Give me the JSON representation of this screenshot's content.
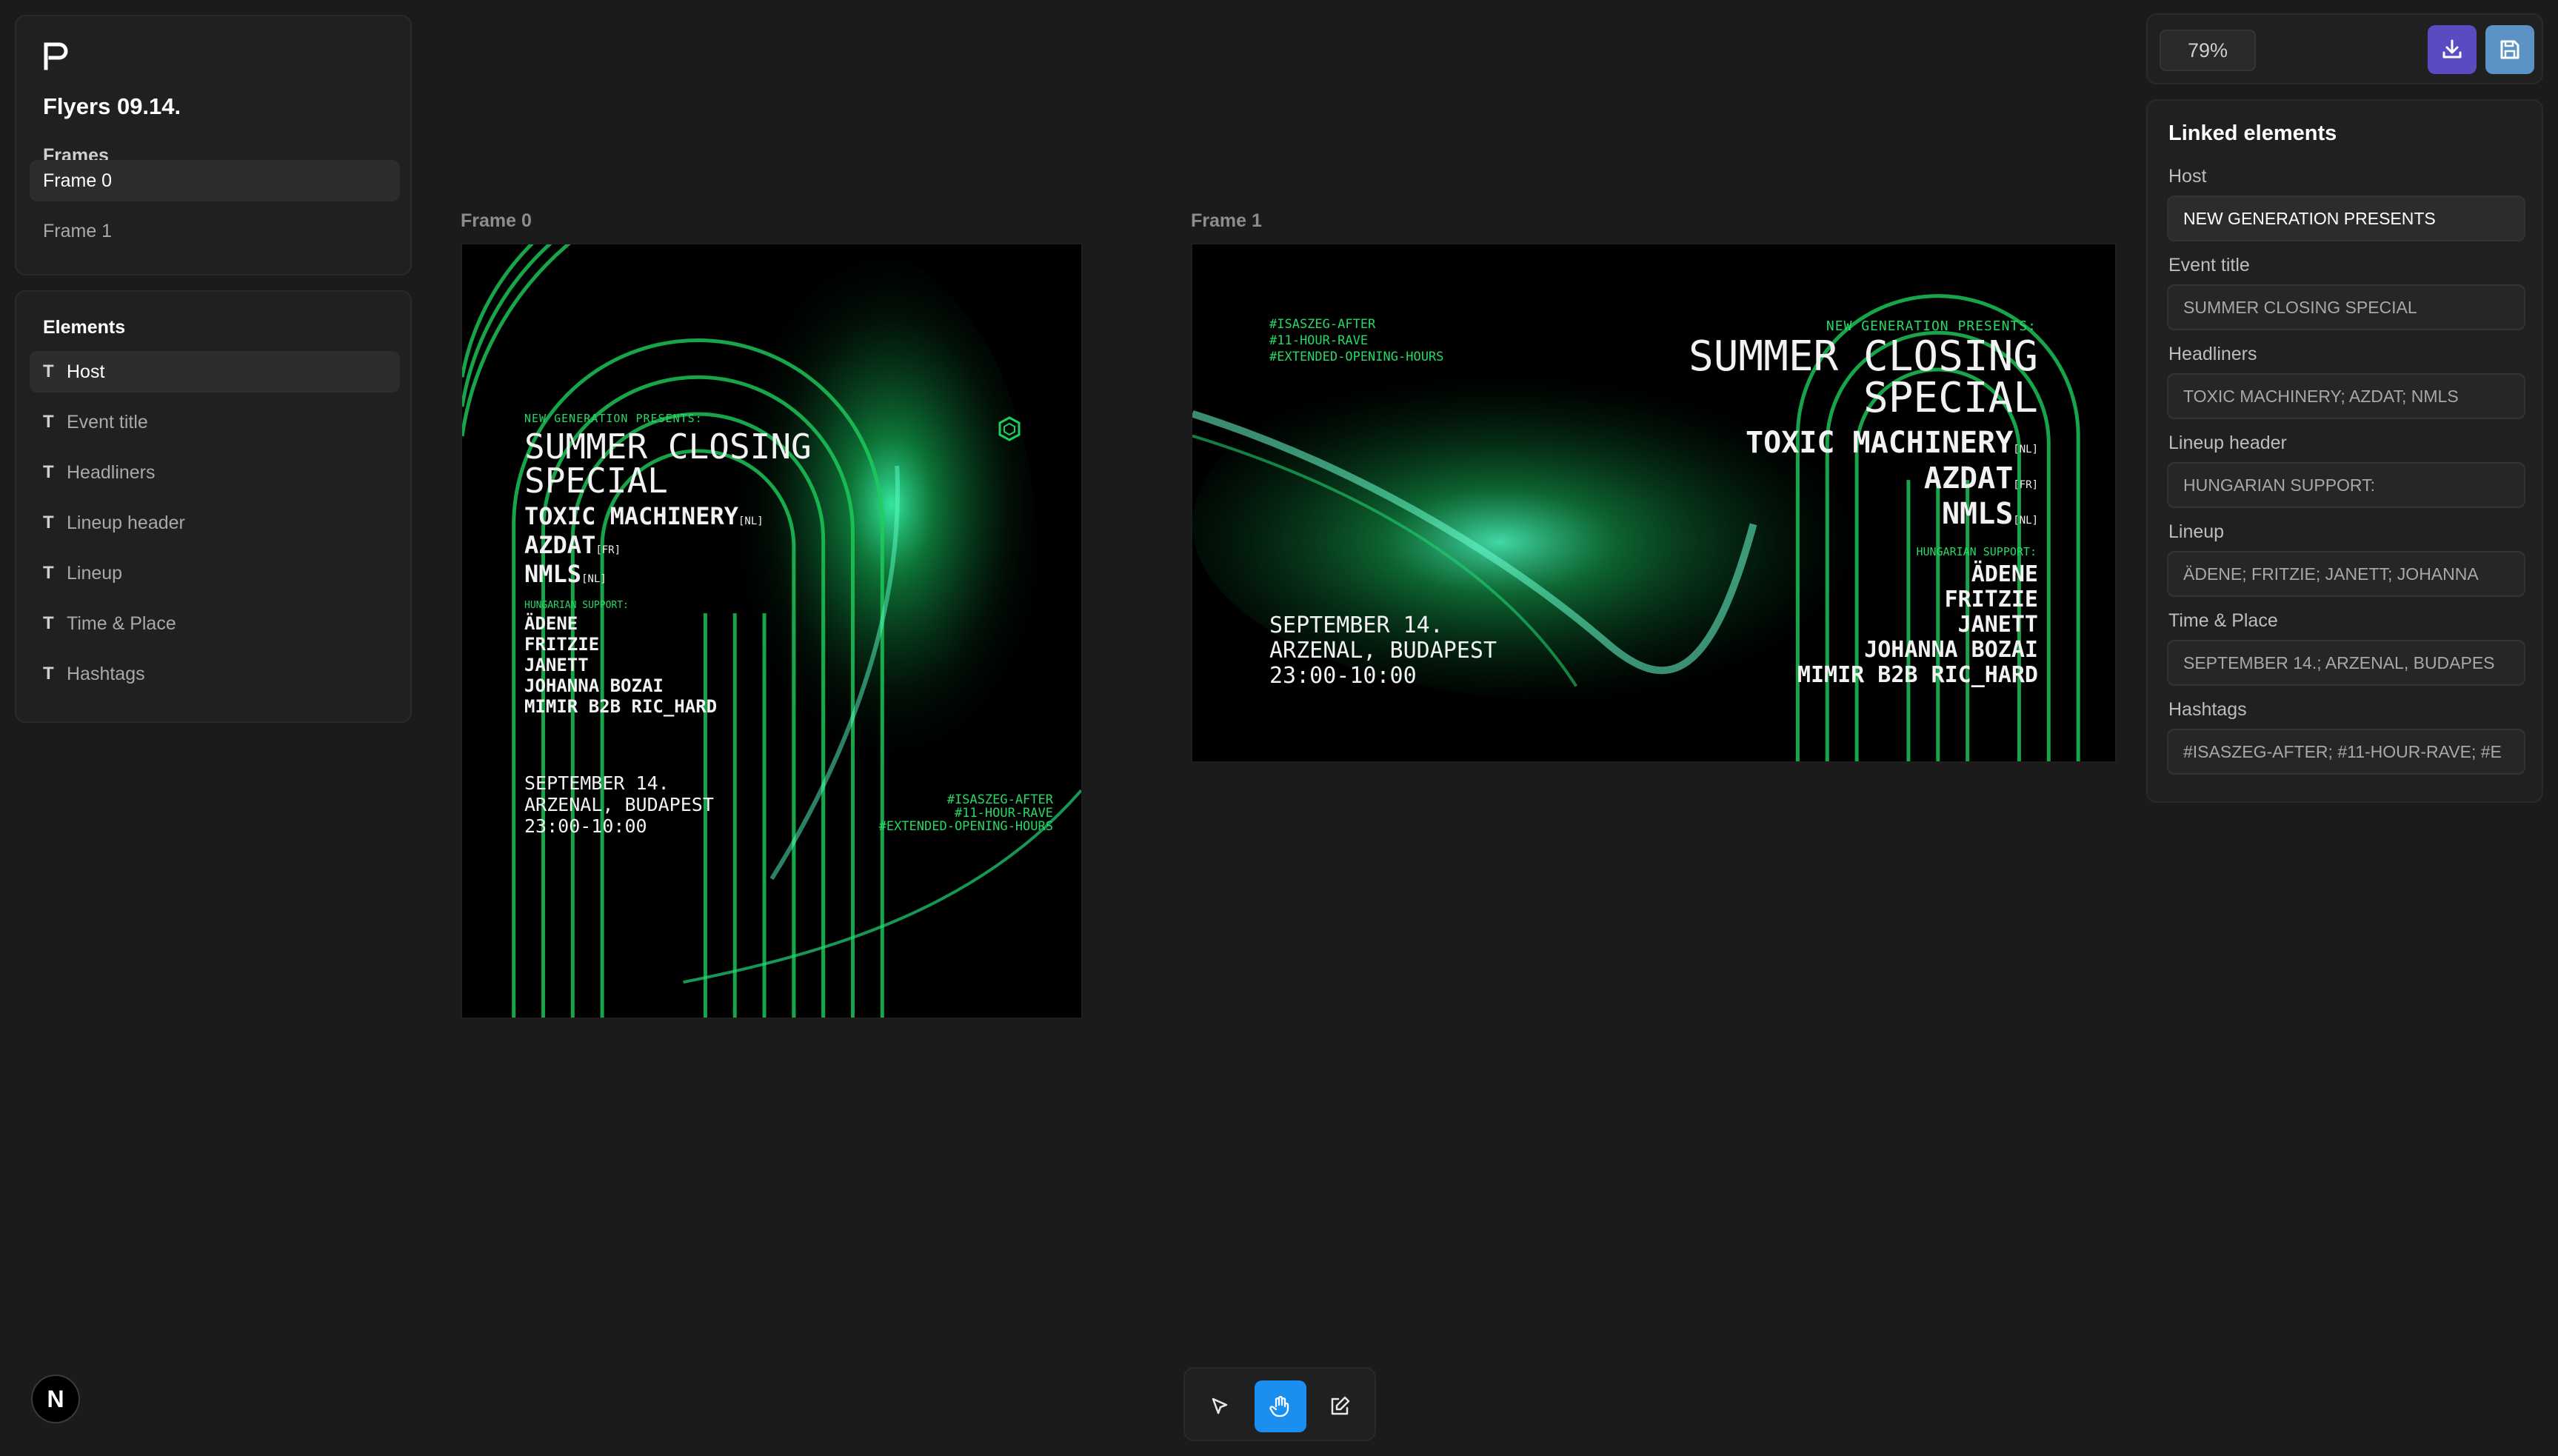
{
  "app": {
    "doc_title": "Flyers 09.14.",
    "logo_glyph": "P",
    "corner_badge": "N"
  },
  "frames_panel": {
    "label": "Frames",
    "items": [
      {
        "label": "Frame 0",
        "active": true
      },
      {
        "label": "Frame 1",
        "active": false
      }
    ]
  },
  "elements_panel": {
    "label": "Elements",
    "type_glyph": "T",
    "items": [
      {
        "label": "Host",
        "active": true
      },
      {
        "label": "Event title"
      },
      {
        "label": "Headliners"
      },
      {
        "label": "Lineup header"
      },
      {
        "label": "Lineup"
      },
      {
        "label": "Time & Place"
      },
      {
        "label": "Hashtags"
      }
    ]
  },
  "canvas": {
    "frames": [
      {
        "label": "Frame 0"
      },
      {
        "label": "Frame 1"
      }
    ]
  },
  "flyer": {
    "host": "NEW GENERATION PRESENTS:",
    "title_line1": "SUMMER CLOSING",
    "title_line2": "SPECIAL",
    "headliners": [
      {
        "name": "TOXIC MACHINERY",
        "country": "[NL]"
      },
      {
        "name": "AZDAT",
        "country": "[FR]"
      },
      {
        "name": "NMLS",
        "country": "[NL]"
      }
    ],
    "lineup_header": "HUNGARIAN SUPPORT:",
    "lineup": [
      "ÄDENE",
      "FRITZIE",
      "JANETT",
      "JOHANNA BOZAI",
      "MIMIR B2B RIC_HARD"
    ],
    "time_place": [
      "SEPTEMBER 14.",
      "ARZENAL, BUDAPEST",
      "23:00-10:00"
    ],
    "hashtags": [
      "#ISASZEG-AFTER",
      "#11-HOUR-RAVE",
      "#EXTENDED-OPENING-HOURS"
    ]
  },
  "topbar": {
    "zoom": "79%",
    "export_icon": "download-icon",
    "save_icon": "save-icon"
  },
  "linked_panel": {
    "title": "Linked elements",
    "fields": [
      {
        "label": "Host",
        "value": "NEW GENERATION PRESENTS",
        "active": true
      },
      {
        "label": "Event title",
        "value": "SUMMER CLOSING SPECIAL"
      },
      {
        "label": "Headliners",
        "value": "TOXIC MACHINERY; AZDAT; NMLS"
      },
      {
        "label": "Lineup header",
        "value": "HUNGARIAN SUPPORT:"
      },
      {
        "label": "Lineup",
        "value": "ÄDENE; FRITZIE; JANETT; JOHANNA"
      },
      {
        "label": "Time & Place",
        "value": "SEPTEMBER 14.; ARZENAL, BUDAPES"
      },
      {
        "label": "Hashtags",
        "value": "#ISASZEG-AFTER; #11-HOUR-RAVE; #E"
      }
    ]
  },
  "toolbar": {
    "tools": [
      "select-tool",
      "hand-tool",
      "edit-tool"
    ],
    "active_tool": "hand-tool",
    "accent": "#1a8ff0"
  }
}
